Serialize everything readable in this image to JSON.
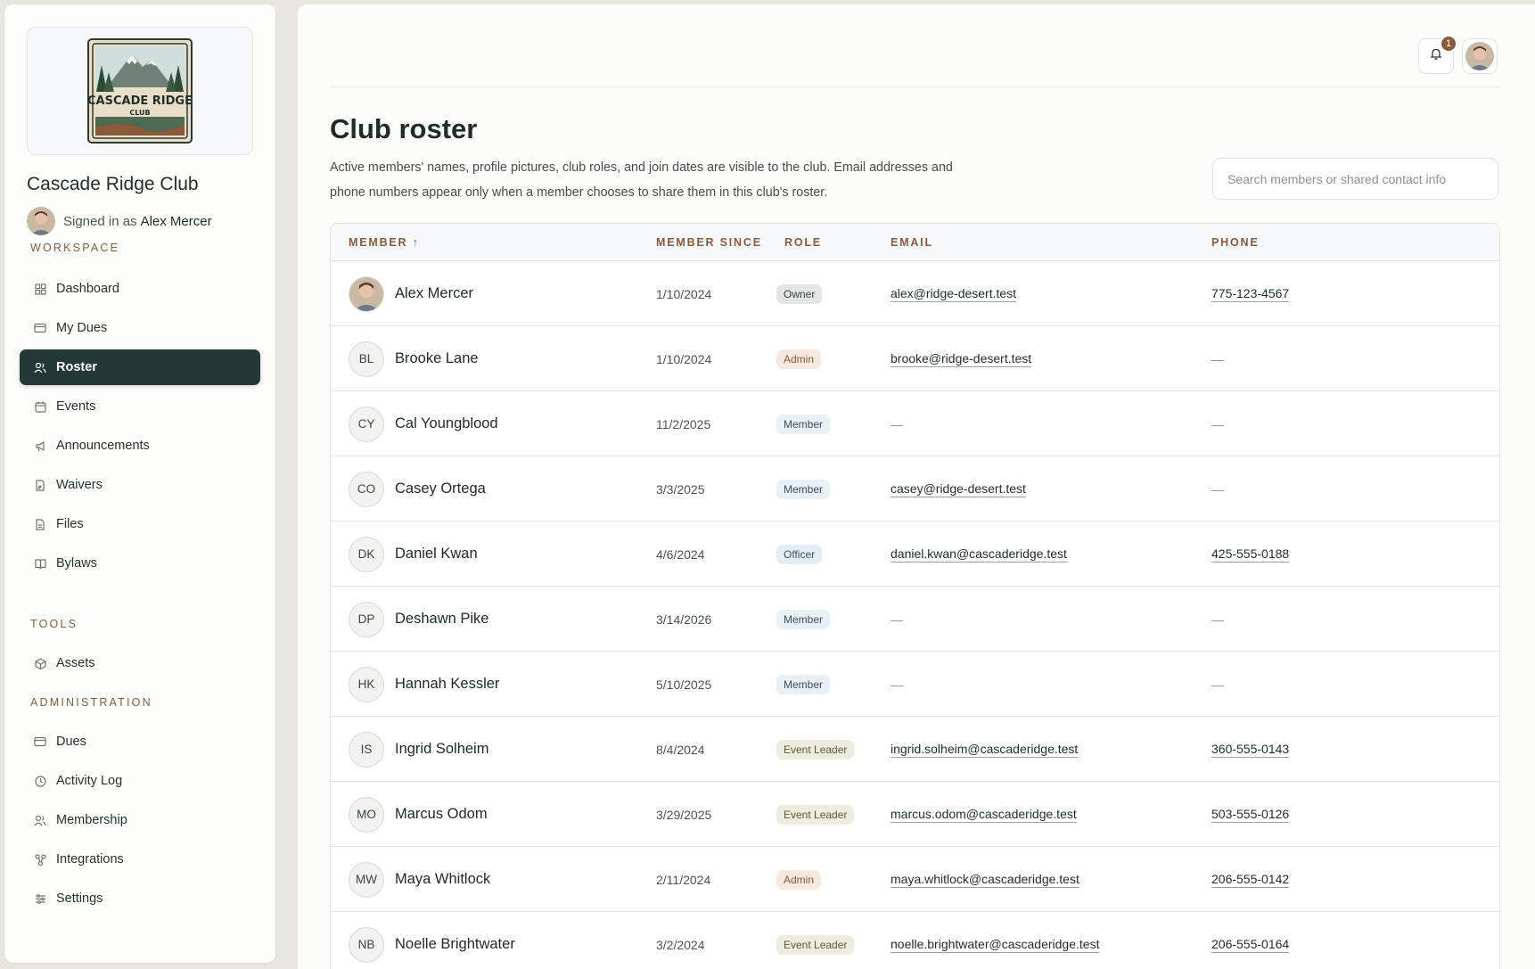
{
  "sidebar": {
    "club_name": "Cascade Ridge Club",
    "logo": {
      "line1": "CASCADE RIDGE",
      "line2": "CLUB"
    },
    "signed_in_prefix": "Signed in as",
    "signed_in_user": "Alex Mercer",
    "sections": [
      {
        "title": "WORKSPACE",
        "items": [
          {
            "label": "Dashboard",
            "icon": "grid-icon"
          },
          {
            "label": "My Dues",
            "icon": "card-icon"
          },
          {
            "label": "Roster",
            "icon": "users-icon",
            "active": true
          },
          {
            "label": "Events",
            "icon": "calendar-icon"
          },
          {
            "label": "Announcements",
            "icon": "megaphone-icon"
          },
          {
            "label": "Waivers",
            "icon": "document-sign-icon"
          },
          {
            "label": "Files",
            "icon": "file-icon"
          },
          {
            "label": "Bylaws",
            "icon": "book-icon"
          }
        ]
      },
      {
        "title": "TOOLS",
        "items": [
          {
            "label": "Assets",
            "icon": "box-icon"
          }
        ]
      },
      {
        "title": "ADMINISTRATION",
        "items": [
          {
            "label": "Dues",
            "icon": "card-icon"
          },
          {
            "label": "Activity Log",
            "icon": "clock-icon"
          },
          {
            "label": "Membership",
            "icon": "users-icon"
          },
          {
            "label": "Integrations",
            "icon": "nodes-icon"
          },
          {
            "label": "Settings",
            "icon": "sliders-icon"
          }
        ]
      }
    ]
  },
  "header": {
    "notification_count": "1"
  },
  "main": {
    "title": "Club roster",
    "description": "Active members' names, profile pictures, club roles, and join dates are visible to the club. Email addresses and phone numbers appear only when a member chooses to share them in this club's roster.",
    "search_placeholder": "Search members or shared contact info"
  },
  "table": {
    "columns": {
      "member": "MEMBER ↑",
      "since": "MEMBER SINCE",
      "role": "ROLE",
      "email": "EMAIL",
      "phone": "PHONE"
    },
    "empty": "—",
    "rows": [
      {
        "initials": "",
        "photo": true,
        "name": "Alex Mercer",
        "since": "1/10/2024",
        "role": "Owner",
        "email": "alex@ridge-desert.test",
        "phone": "775-123-4567"
      },
      {
        "initials": "BL",
        "name": "Brooke Lane",
        "since": "1/10/2024",
        "role": "Admin",
        "email": "brooke@ridge-desert.test",
        "phone": ""
      },
      {
        "initials": "CY",
        "name": "Cal Youngblood",
        "since": "11/2/2025",
        "role": "Member",
        "email": "",
        "phone": ""
      },
      {
        "initials": "CO",
        "name": "Casey Ortega",
        "since": "3/3/2025",
        "role": "Member",
        "email": "casey@ridge-desert.test",
        "phone": ""
      },
      {
        "initials": "DK",
        "name": "Daniel Kwan",
        "since": "4/6/2024",
        "role": "Officer",
        "email": "daniel.kwan@cascaderidge.test",
        "phone": "425-555-0188"
      },
      {
        "initials": "DP",
        "name": "Deshawn Pike",
        "since": "3/14/2026",
        "role": "Member",
        "email": "",
        "phone": ""
      },
      {
        "initials": "HK",
        "name": "Hannah Kessler",
        "since": "5/10/2025",
        "role": "Member",
        "email": "",
        "phone": ""
      },
      {
        "initials": "IS",
        "name": "Ingrid Solheim",
        "since": "8/4/2024",
        "role": "Event Leader",
        "email": "ingrid.solheim@cascaderidge.test",
        "phone": "360-555-0143"
      },
      {
        "initials": "MO",
        "name": "Marcus Odom",
        "since": "3/29/2025",
        "role": "Event Leader",
        "email": "marcus.odom@cascaderidge.test",
        "phone": "503-555-0126"
      },
      {
        "initials": "MW",
        "name": "Maya Whitlock",
        "since": "2/11/2024",
        "role": "Admin",
        "email": "maya.whitlock@cascaderidge.test",
        "phone": "206-555-0142"
      },
      {
        "initials": "NB",
        "name": "Noelle Brightwater",
        "since": "3/2/2024",
        "role": "Event Leader",
        "email": "noelle.brightwater@cascaderidge.test",
        "phone": "206-555-0164"
      }
    ]
  }
}
